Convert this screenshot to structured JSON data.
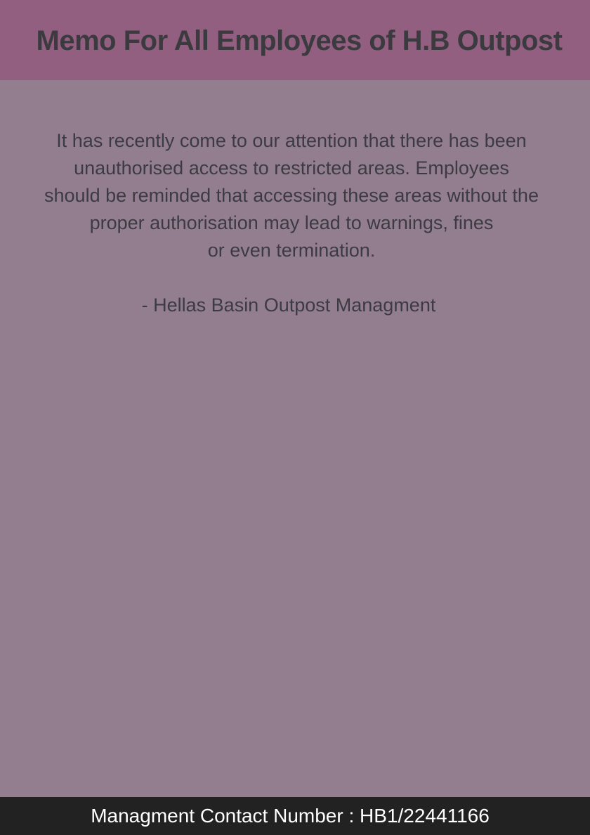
{
  "header": {
    "title": "Memo For All Employees of H.B Outpost"
  },
  "memo": {
    "body_lines": [
      "It has recently come to our attention that there has been",
      "unauthorised access to restricted areas. Employees",
      "should be reminded that accessing these areas without the",
      "proper authorisation may lead to warnings, fines",
      "or even termination."
    ],
    "signature": "- Hellas Basin Outpost Managment"
  },
  "footer": {
    "contact": "Managment Contact Number : HB1/22441166"
  },
  "colors": {
    "header_bg": "#935f81",
    "page_bg": "#937e8f",
    "footer_bg": "#222222",
    "text": "#3d3b42"
  }
}
